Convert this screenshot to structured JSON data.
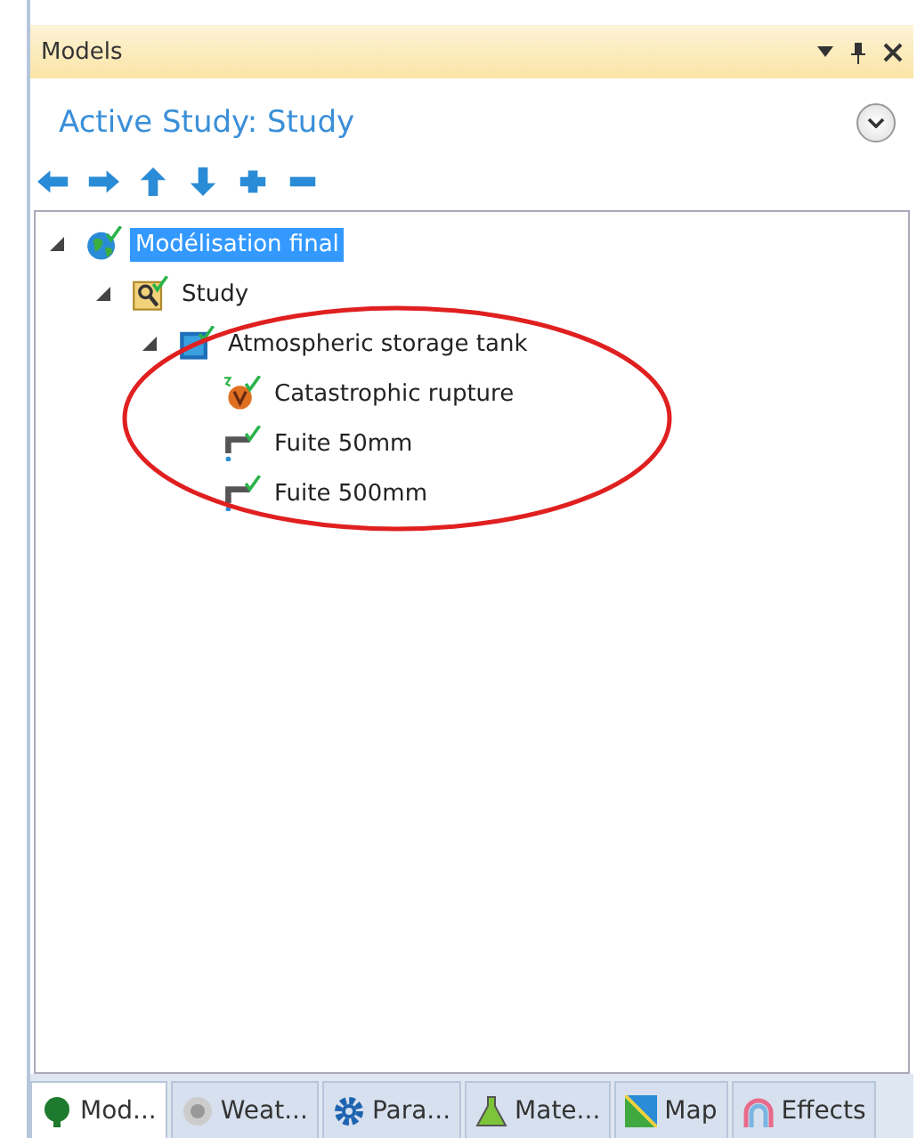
{
  "panel": {
    "title": "Models",
    "header": "Active Study: Study"
  },
  "toolbar": [
    {
      "kind": "left"
    },
    {
      "kind": "right"
    },
    {
      "kind": "up"
    },
    {
      "kind": "down"
    },
    {
      "kind": "add"
    },
    {
      "kind": "remove"
    }
  ],
  "tree": [
    {
      "label": "Modélisation final",
      "kind": "globe",
      "expanded": true,
      "selected": true,
      "children": [
        {
          "label": "Study",
          "kind": "study",
          "expanded": true,
          "selected": false,
          "children": [
            {
              "label": "Atmospheric storage tank",
              "kind": "tank",
              "expanded": true,
              "selected": false,
              "children": [
                {
                  "label": "Catastrophic rupture",
                  "kind": "rupture",
                  "selected": false
                },
                {
                  "label": "Fuite 50mm",
                  "kind": "leak",
                  "selected": false
                },
                {
                  "label": "Fuite 500mm",
                  "kind": "leak",
                  "selected": false
                }
              ]
            }
          ]
        }
      ]
    }
  ],
  "tabs": [
    {
      "label": "Mod...",
      "kind": "tree",
      "selected": true
    },
    {
      "label": "Weat...",
      "kind": "weather",
      "selected": false
    },
    {
      "label": "Para...",
      "kind": "gear",
      "selected": false
    },
    {
      "label": "Mate...",
      "kind": "flask",
      "selected": false
    },
    {
      "label": "Map",
      "kind": "map",
      "selected": false
    },
    {
      "label": "Effects",
      "kind": "rainbow",
      "selected": false
    }
  ]
}
